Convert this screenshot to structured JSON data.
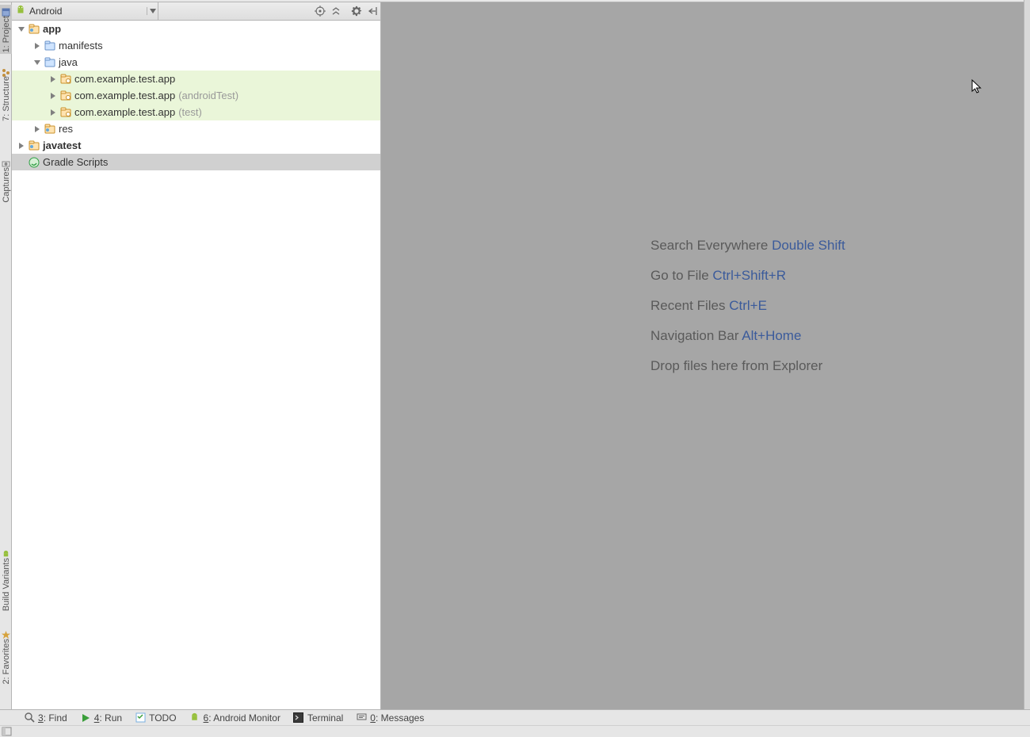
{
  "left_tabs": {
    "project": {
      "label": "1: Project"
    },
    "structure": {
      "label": "7: Structure"
    },
    "captures": {
      "label": "Captures"
    },
    "buildvar": {
      "label": "Build Variants"
    },
    "favorites": {
      "label": "2: Favorites"
    }
  },
  "project_panel": {
    "dropdown_label": "Android",
    "nodes": [
      {
        "depth": 0,
        "arrow": "open",
        "icon": "module",
        "label": "app",
        "bold": true
      },
      {
        "depth": 1,
        "arrow": "closed",
        "icon": "folder",
        "label": "manifests"
      },
      {
        "depth": 1,
        "arrow": "open",
        "icon": "folder",
        "label": "java"
      },
      {
        "depth": 2,
        "arrow": "closed",
        "icon": "package",
        "label": "com.example.test.app",
        "hl": true
      },
      {
        "depth": 2,
        "arrow": "closed",
        "icon": "package",
        "label": "com.example.test.app",
        "suffix": "(androidTest)",
        "hl": true
      },
      {
        "depth": 2,
        "arrow": "closed",
        "icon": "package",
        "label": "com.example.test.app",
        "suffix": "(test)",
        "hl": true
      },
      {
        "depth": 1,
        "arrow": "closed",
        "icon": "module",
        "label": "res"
      },
      {
        "depth": 0,
        "arrow": "closed",
        "icon": "module",
        "label": "javatest",
        "bold": true
      },
      {
        "depth": 0,
        "arrow": "none",
        "icon": "gradle",
        "label": "Gradle Scripts",
        "selected": true
      }
    ]
  },
  "editor_tips": [
    {
      "text": "Search Everywhere ",
      "shortcut": "Double Shift"
    },
    {
      "text": "Go to File ",
      "shortcut": "Ctrl+Shift+R"
    },
    {
      "text": "Recent Files ",
      "shortcut": "Ctrl+E"
    },
    {
      "text": "Navigation Bar ",
      "shortcut": "Alt+Home"
    },
    {
      "text": "Drop files here from Explorer",
      "shortcut": ""
    }
  ],
  "bottom_bar": [
    {
      "icon": "search",
      "ul": "3",
      "label": ": Find"
    },
    {
      "icon": "run",
      "ul": "4",
      "label": ": Run"
    },
    {
      "icon": "todo",
      "ul": "",
      "label": "TODO"
    },
    {
      "icon": "android",
      "ul": "6",
      "label": ": Android Monitor"
    },
    {
      "icon": "terminal",
      "ul": "",
      "label": "Terminal"
    },
    {
      "icon": "messages",
      "ul": "0",
      "label": ": Messages"
    }
  ]
}
